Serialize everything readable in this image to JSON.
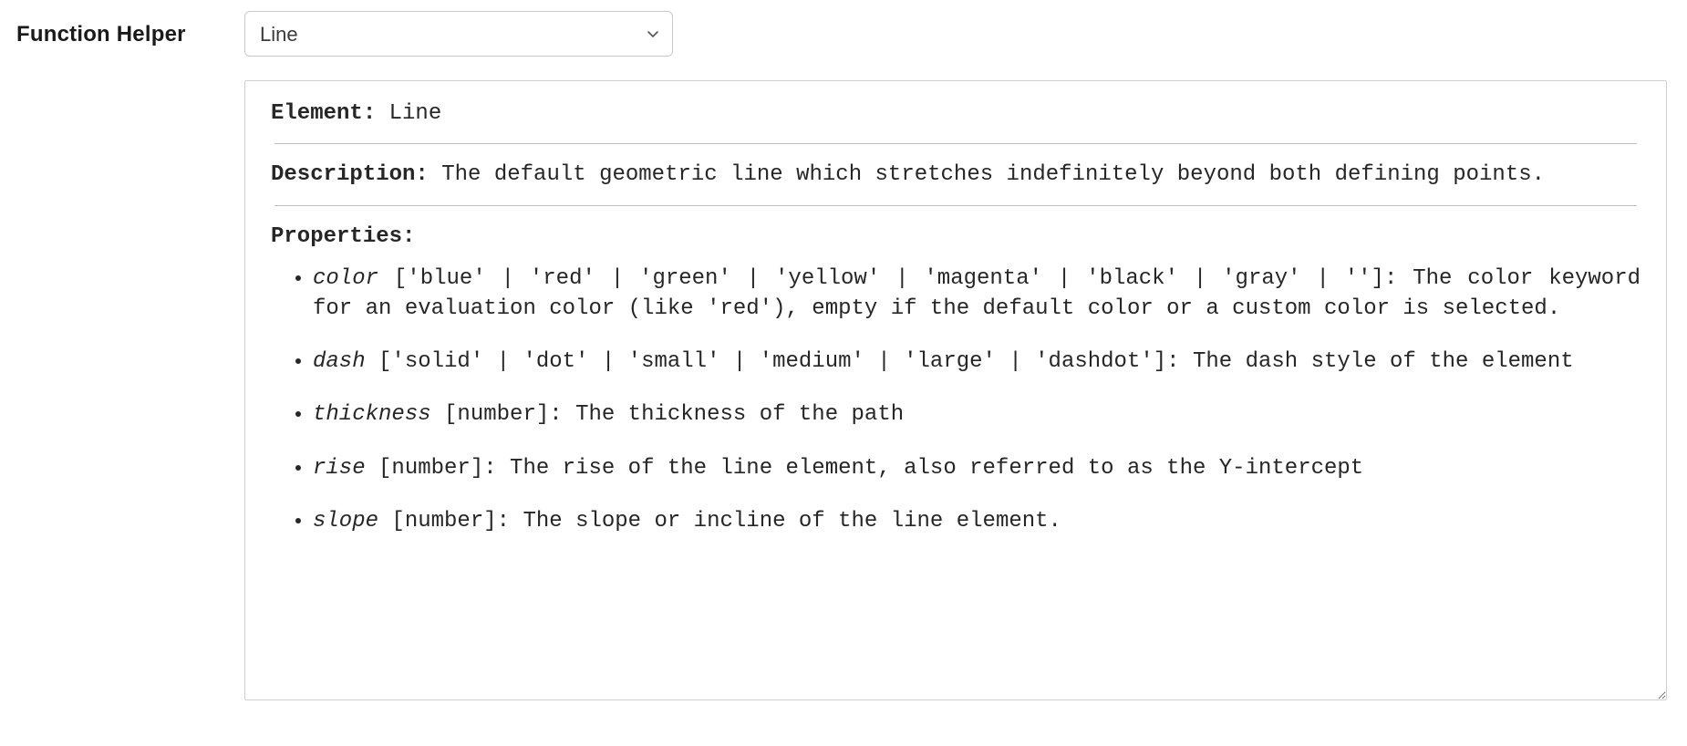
{
  "sidebar": {
    "heading": "Function Helper"
  },
  "selector": {
    "selected": "Line"
  },
  "doc": {
    "element_label": "Element:",
    "element_value": "Line",
    "description_label": "Description:",
    "description_text": "The default geometric line which stretches indefinitely beyond both defining points.",
    "properties_label": "Properties:",
    "props": [
      {
        "name": "color",
        "type": "['blue' | 'red' | 'green' | 'yellow' | 'magenta' | 'black' | 'gray' | '']",
        "desc": "The color keyword for an evaluation color (like 'red'), empty if the default color or a custom color is selected."
      },
      {
        "name": "dash",
        "type": "['solid' | 'dot' | 'small' | 'medium' | 'large' | 'dashdot']",
        "desc": "The dash style of the element"
      },
      {
        "name": "thickness",
        "type": "[number]",
        "desc": "The thickness of the path"
      },
      {
        "name": "rise",
        "type": "[number]",
        "desc": "The rise of the line element, also referred to as the Y-intercept"
      },
      {
        "name": "slope",
        "type": "[number]",
        "desc": "The slope or incline of the line element."
      }
    ]
  }
}
